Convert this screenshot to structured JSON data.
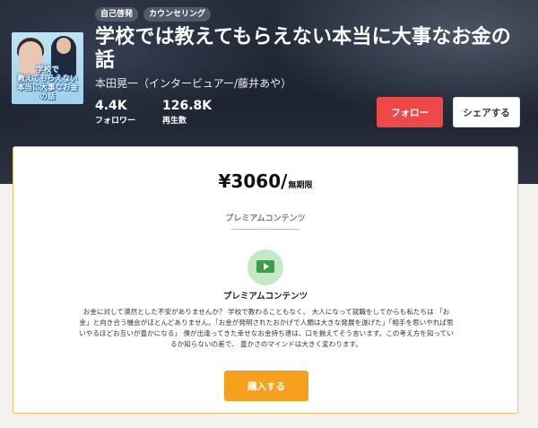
{
  "header": {
    "tags": [
      "自己啓発",
      "カウンセリング"
    ],
    "title": "学校では教えてもらえない本当に大事なお金の話",
    "author": "本田晃一（インタービュアー/藤井あや）",
    "thumbnail_caption": [
      "学校で",
      "教えてもらえない",
      "本当に大事なお金の話"
    ],
    "stats": [
      {
        "value": "4.4K",
        "label": "フォロワー"
      },
      {
        "value": "126.8K",
        "label": "再生数"
      }
    ],
    "follow_label": "フォロー",
    "share_label": "シェアする"
  },
  "purchase": {
    "price": "¥3060/",
    "period": "無期限",
    "section_label": "プレミアムコンテンツ",
    "content_icon": "video-icon",
    "content_title": "プレミアムコンテンツ",
    "description": "お金に対して漠然とした不安がありませんか？ 学校で教わることもなく、 大人になって就職をしてからも私たちは 「お金」と向き合う機会がほとんどありません。「お金が発明されたおかげで人類は大きな発展を遂げた」「相手を思いやれば思いやるほどお互いが豊かになる」 僕が出逢ってきた幸せなお金持ち達は、口を揃えてそう言います。この考え方を知っているか知らないの差で、 豊かさのマインドは大きく変わります。",
    "buy_label": "購入する"
  },
  "colors": {
    "follow": "#ef4848",
    "buy": "#f7a01e",
    "card_border": "#f3c06d",
    "icon_bg": "#c5e9c6",
    "icon_fg": "#37a046"
  }
}
